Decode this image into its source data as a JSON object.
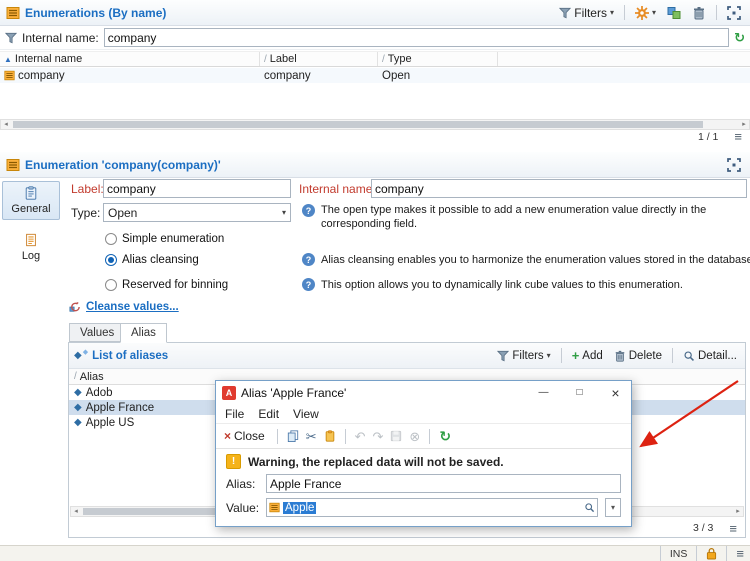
{
  "icons": {
    "dropdown_arrow": "▾",
    "sort_asc": "▲",
    "sort_slash": "/",
    "help_mark": "?",
    "close_x": "×",
    "minimize_glyph": "—",
    "maximize_glyph": "□",
    "scissors_glyph": "✂",
    "undo_glyph": "↶",
    "redo_glyph": "↷",
    "cancel_glyph": "⊗",
    "refresh_glyph": "↻",
    "menu_glyph": "≡",
    "warning_glyph": "!",
    "plus_glyph": "+",
    "diamond_glyph": "◆",
    "app_letter": "A",
    "left_arrow_glyph": "◂",
    "right_arrow_glyph": "▸"
  },
  "top_panel": {
    "title": "Enumerations (By name)",
    "filters_label": "Filters",
    "filter_row": {
      "label": "Internal name:",
      "value": "company"
    },
    "columns": [
      "Internal name",
      "Label",
      "Type"
    ],
    "rows": [
      {
        "internal_name": "company",
        "label": "company",
        "type": "Open"
      }
    ],
    "count": "1 / 1"
  },
  "detail_panel": {
    "title": "Enumeration 'company(company)'",
    "side_tabs": [
      {
        "label": "General"
      },
      {
        "label": "Log"
      }
    ],
    "form": {
      "label_field": {
        "label": "Label:",
        "value": "company"
      },
      "internal_name_field": {
        "label": "Internal name:",
        "value": "company"
      },
      "type_field": {
        "label": "Type:",
        "value": "Open"
      },
      "type_help": "The open type makes it possible to add a new enumeration value directly in the corresponding field.",
      "options": [
        {
          "label": "Simple enumeration",
          "selected": false
        },
        {
          "label": "Alias cleansing",
          "selected": true
        },
        {
          "label": "Reserved for binning",
          "selected": false
        }
      ],
      "alias_help": "Alias cleansing enables you to harmonize the enumeration values stored in the database.",
      "binning_help": "This option allows you to dynamically link cube values to this enumeration.",
      "cleanse_link": "Cleanse values..."
    },
    "sub_tabs": [
      {
        "label": "Values"
      },
      {
        "label": "Alias"
      }
    ],
    "alias_panel": {
      "title": "List of aliases",
      "filters_label": "Filters",
      "add_label": "Add",
      "delete_label": "Delete",
      "detail_label": "Detail...",
      "column": "Alias",
      "rows": [
        {
          "name": "Adob"
        },
        {
          "name": "Apple France"
        },
        {
          "name": "Apple US"
        }
      ],
      "count": "3 / 3"
    }
  },
  "dialog": {
    "title": "Alias 'Apple France'",
    "menu": [
      "File",
      "Edit",
      "View"
    ],
    "close_label": "Close",
    "warning_text": "Warning, the replaced data will not be saved.",
    "alias_field": {
      "label": "Alias:",
      "value": "Apple France"
    },
    "value_field": {
      "label": "Value:",
      "value": "Apple"
    }
  },
  "status_bar": {
    "ins_label": "INS"
  }
}
